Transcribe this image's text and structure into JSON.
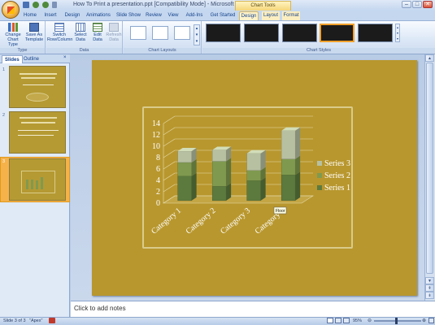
{
  "window": {
    "title": "How To Print a presentation.ppt [Compatibility Mode] - Microsoft PowerPoint",
    "contextual_tab_group": "Chart Tools",
    "min": "–",
    "max": "□",
    "close": "✕"
  },
  "tabs": [
    "Home",
    "Insert",
    "Design",
    "Animations",
    "Slide Show",
    "Review",
    "View",
    "Add-Ins",
    "Get Started",
    "Design",
    "Layout",
    "Format"
  ],
  "ribbon": {
    "type_group": {
      "label": "Type",
      "change_chart_type": "Change Chart Type",
      "save_as_template": "Save As Template"
    },
    "data_group": {
      "label": "Data",
      "switch_row_column": "Switch Row/Column",
      "select_data": "Select Data",
      "edit_data": "Edit Data",
      "refresh_data": "Refresh Data"
    },
    "chart_layouts_label": "Chart Layouts",
    "chart_styles_label": "Chart Styles"
  },
  "left_panel": {
    "tabs": [
      "Slides",
      "Outline"
    ],
    "close": "×",
    "slide_numbers": [
      "1",
      "2",
      "3"
    ]
  },
  "notes_placeholder": "Click to add notes",
  "status": {
    "slide_of": "Slide 3 of 3",
    "theme": "\"Apex\"",
    "zoom": "95%"
  },
  "chart_data": {
    "type": "bar",
    "stacked": true,
    "categories": [
      "Category 1",
      "Category 2",
      "Category 3",
      "Category 4"
    ],
    "series": [
      {
        "name": "Series 1",
        "values": [
          4.3,
          2.5,
          3.5,
          4.5
        ],
        "color": "#5c7a3e"
      },
      {
        "name": "Series 2",
        "values": [
          2.4,
          4.4,
          1.8,
          2.8
        ],
        "color": "#7f9a4f"
      },
      {
        "name": "Series 3",
        "values": [
          2.0,
          2.0,
          3.0,
          5.0
        ],
        "color": "#b7c0a1"
      }
    ],
    "yticks": [
      "0",
      "2",
      "4",
      "6",
      "8",
      "10",
      "12",
      "14"
    ],
    "ylim": [
      0,
      14
    ],
    "legend_position": "right",
    "tooltip": "Floor"
  }
}
